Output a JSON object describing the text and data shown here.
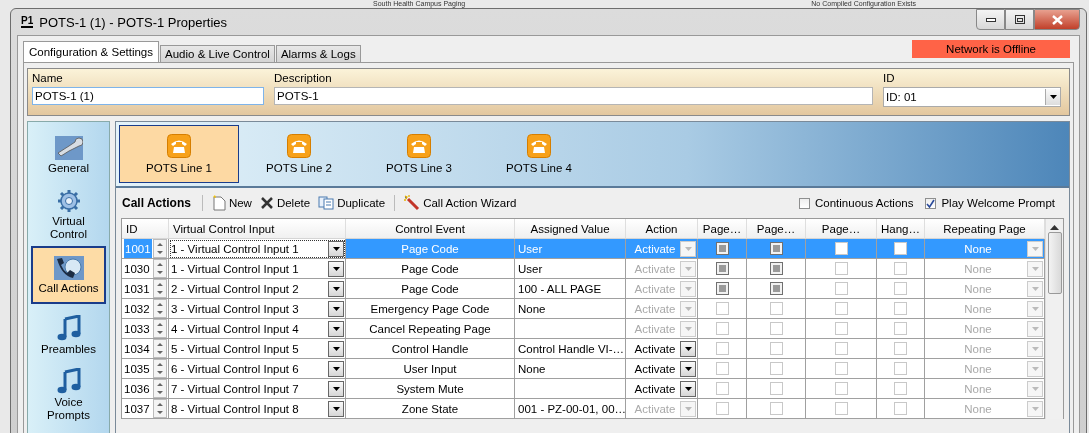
{
  "background_titles": [
    "South Health Campus Paging",
    "No Compiled Configuration Exists"
  ],
  "window": {
    "badge": "P1",
    "title": "POTS-1 (1) - POTS-1 Properties"
  },
  "tabs": [
    {
      "label": "Configuration & Settings",
      "selected": true
    },
    {
      "label": "Audio & Live Control",
      "selected": false
    },
    {
      "label": "Alarms & Logs",
      "selected": false
    }
  ],
  "network_status": "Network is Offline",
  "fields": {
    "name": {
      "label": "Name",
      "value": "POTS-1 (1)"
    },
    "description": {
      "label": "Description",
      "value": "POTS-1"
    },
    "id": {
      "label": "ID",
      "value": "ID: 01"
    }
  },
  "sidebar": {
    "items": [
      {
        "label": "General",
        "kind": "wrench",
        "selected": false
      },
      {
        "label": "Virtual Control",
        "kind": "gear",
        "selected": false
      },
      {
        "label": "Call Actions",
        "kind": "phone",
        "selected": true
      },
      {
        "label": "Preambles",
        "kind": "music",
        "selected": false
      },
      {
        "label": "Voice Prompts",
        "kind": "music",
        "selected": false
      }
    ]
  },
  "lines": [
    {
      "label": "POTS Line 1",
      "selected": true
    },
    {
      "label": "POTS Line 2",
      "selected": false
    },
    {
      "label": "POTS Line 3",
      "selected": false
    },
    {
      "label": "POTS Line 4",
      "selected": false
    }
  ],
  "toolbar": {
    "title": "Call Actions",
    "buttons": [
      {
        "label": "New",
        "kind": "new"
      },
      {
        "label": "Delete",
        "kind": "delete"
      },
      {
        "label": "Duplicate",
        "kind": "duplicate"
      },
      {
        "label": "Call Action Wizard",
        "kind": "wizard"
      }
    ],
    "options": [
      {
        "label": "Continuous Actions",
        "checked": false
      },
      {
        "label": "Play Welcome Prompt",
        "checked": true
      }
    ]
  },
  "table": {
    "columns": [
      "ID",
      "Virtual Control Input",
      "Control Event",
      "Assigned Value",
      "Action",
      "Page…",
      "Page…",
      "Page…",
      "Hang…",
      "Repeating Page"
    ],
    "rows": [
      {
        "id": "1001",
        "input": "1 - Virtual Control Input 1",
        "event": "Page Code",
        "value": "User",
        "action": "Activate",
        "action_enabled": false,
        "checks": [
          {
            "checked": true,
            "disabled": false
          },
          {
            "checked": true,
            "disabled": false
          },
          {
            "checked": false,
            "disabled": true
          },
          {
            "checked": false,
            "disabled": true
          }
        ],
        "repeating": "None",
        "selected": true
      },
      {
        "id": "1030",
        "input": "1 - Virtual Control Input 1",
        "event": "Page Code",
        "value": "User",
        "action": "Activate",
        "action_enabled": false,
        "checks": [
          {
            "checked": true,
            "disabled": false
          },
          {
            "checked": true,
            "disabled": false
          },
          {
            "checked": false,
            "disabled": true
          },
          {
            "checked": false,
            "disabled": true
          }
        ],
        "repeating": "None",
        "selected": false
      },
      {
        "id": "1031",
        "input": "2 - Virtual Control Input 2",
        "event": "Page Code",
        "value": "100 - ALL PAGE",
        "action": "Activate",
        "action_enabled": false,
        "checks": [
          {
            "checked": true,
            "disabled": false
          },
          {
            "checked": true,
            "disabled": false
          },
          {
            "checked": false,
            "disabled": true
          },
          {
            "checked": false,
            "disabled": true
          }
        ],
        "repeating": "None",
        "selected": false
      },
      {
        "id": "1032",
        "input": "3 - Virtual Control Input 3",
        "event": "Emergency Page Code",
        "value": "None",
        "action": "Activate",
        "action_enabled": false,
        "checks": [
          {
            "checked": false,
            "disabled": true
          },
          {
            "checked": false,
            "disabled": true
          },
          {
            "checked": false,
            "disabled": true
          },
          {
            "checked": false,
            "disabled": true
          }
        ],
        "repeating": "None",
        "selected": false
      },
      {
        "id": "1033",
        "input": "4 - Virtual Control Input 4",
        "event": "Cancel Repeating Page",
        "action": "Activate",
        "action_enabled": false,
        "checks": [
          {
            "checked": false,
            "disabled": true
          },
          {
            "checked": false,
            "disabled": true
          },
          {
            "checked": false,
            "disabled": true
          },
          {
            "checked": false,
            "disabled": true
          }
        ],
        "repeating": "None",
        "selected": false
      },
      {
        "id": "1034",
        "input": "5 - Virtual Control Input 5",
        "event": "Control Handle",
        "value": "Control Handle VI-…",
        "action": "Activate",
        "action_enabled": true,
        "checks": [
          {
            "checked": false,
            "disabled": true
          },
          {
            "checked": false,
            "disabled": true
          },
          {
            "checked": false,
            "disabled": true
          },
          {
            "checked": false,
            "disabled": true
          }
        ],
        "repeating": "None",
        "selected": false
      },
      {
        "id": "1035",
        "input": "6 - Virtual Control Input 6",
        "event": "User Input",
        "value": "None",
        "action": "Activate",
        "action_enabled": true,
        "checks": [
          {
            "checked": false,
            "disabled": true
          },
          {
            "checked": false,
            "disabled": true
          },
          {
            "checked": false,
            "disabled": true
          },
          {
            "checked": false,
            "disabled": true
          }
        ],
        "repeating": "None",
        "selected": false
      },
      {
        "id": "1036",
        "input": "7 - Virtual Control Input 7",
        "event": "System Mute",
        "action": "Activate",
        "action_enabled": true,
        "checks": [
          {
            "checked": false,
            "disabled": true
          },
          {
            "checked": false,
            "disabled": true
          },
          {
            "checked": false,
            "disabled": true
          },
          {
            "checked": false,
            "disabled": true
          }
        ],
        "repeating": "None",
        "selected": false
      },
      {
        "id": "1037",
        "input": "8 - Virtual Control Input 8",
        "event": "Zone State",
        "value": "001 - PZ-00-01, 00…",
        "action": "Activate",
        "action_enabled": false,
        "checks": [
          {
            "checked": false,
            "disabled": true
          },
          {
            "checked": false,
            "disabled": true
          },
          {
            "checked": false,
            "disabled": true
          },
          {
            "checked": false,
            "disabled": true
          }
        ],
        "repeating": "None",
        "selected": false
      }
    ]
  }
}
